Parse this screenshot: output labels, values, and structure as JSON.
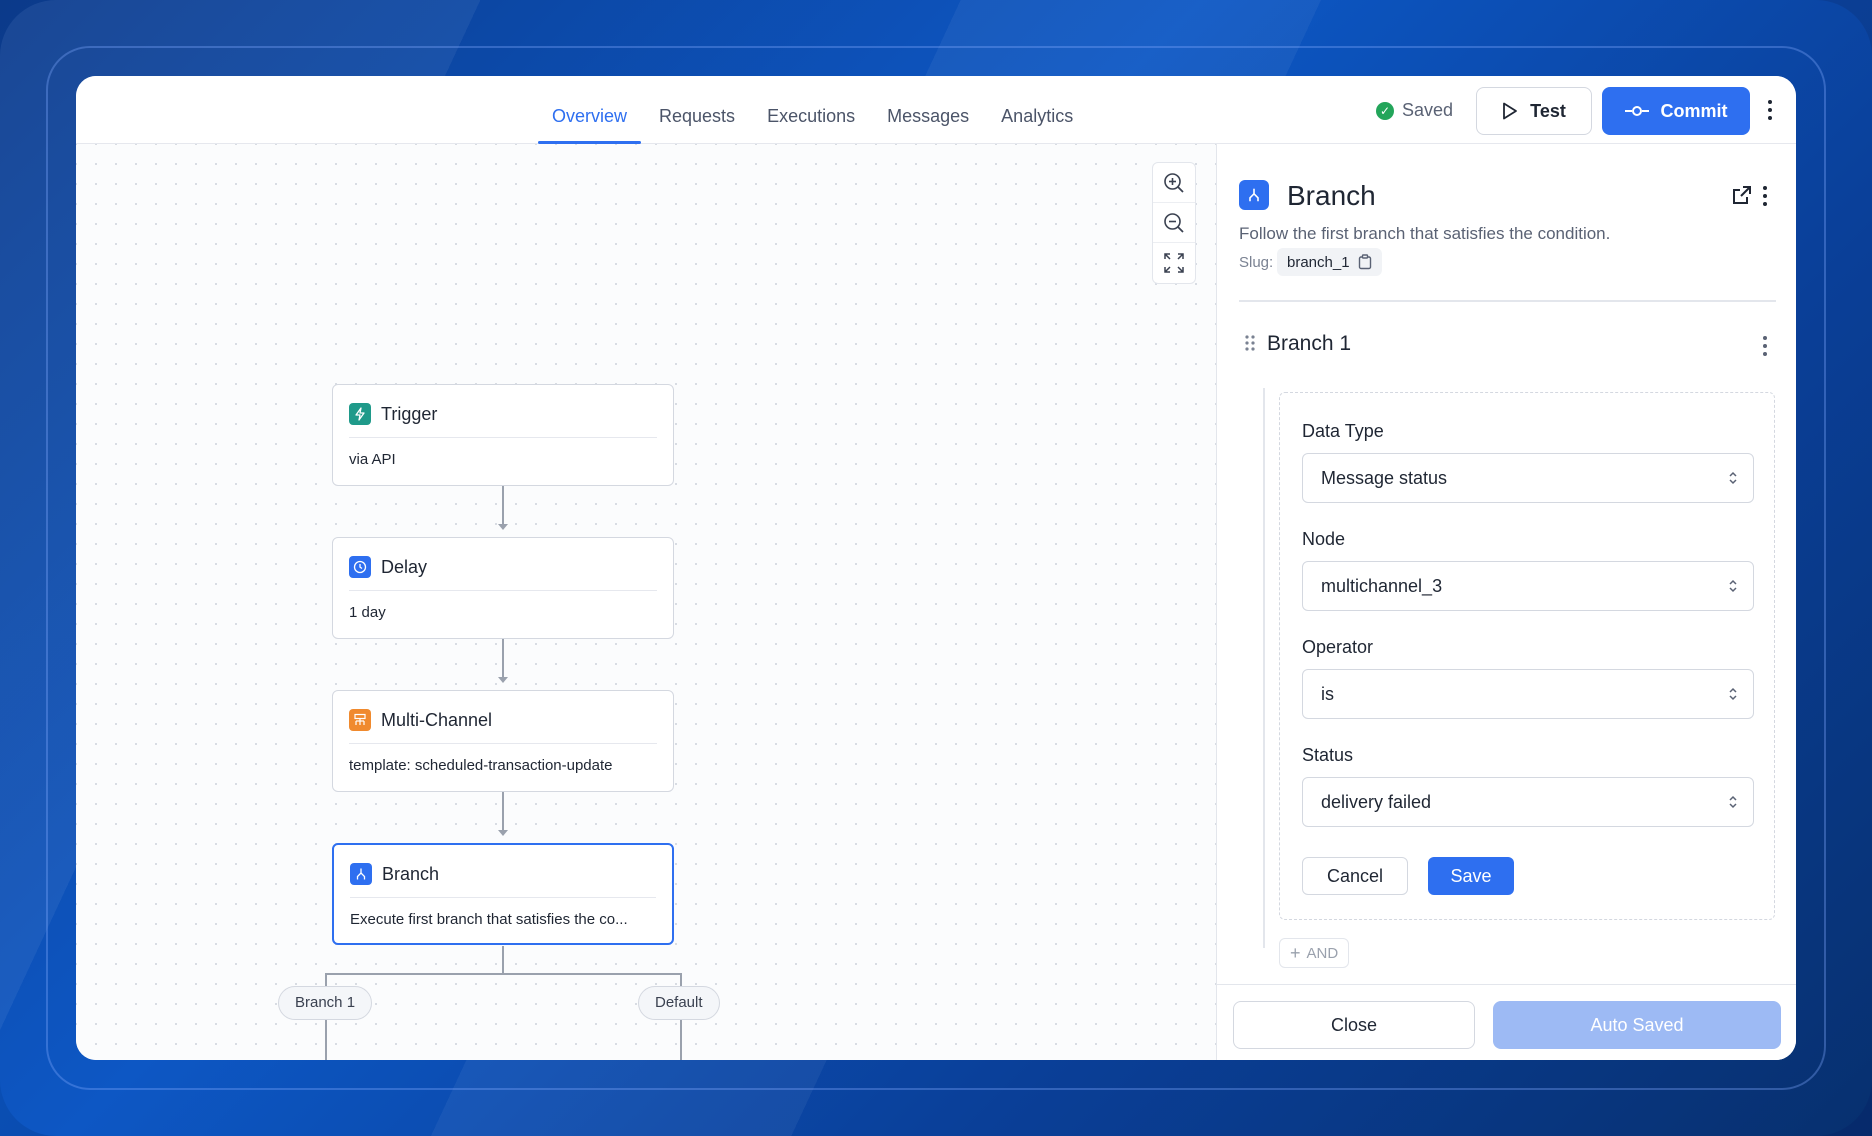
{
  "tabs": [
    {
      "label": "Overview",
      "active": true
    },
    {
      "label": "Requests",
      "active": false
    },
    {
      "label": "Executions",
      "active": false
    },
    {
      "label": "Messages",
      "active": false
    },
    {
      "label": "Analytics",
      "active": false
    }
  ],
  "header": {
    "saved_label": "Saved",
    "test_label": "Test",
    "commit_label": "Commit"
  },
  "nodes": [
    {
      "title": "Trigger",
      "body": "via API",
      "icon": "bolt-icon",
      "color": "#1f9a8a"
    },
    {
      "title": "Delay",
      "body": "1 day",
      "icon": "clock-icon",
      "color": "#2e6ff0"
    },
    {
      "title": "Multi-Channel",
      "body": "template: scheduled-transaction-update",
      "icon": "multichannel-icon",
      "color": "#f08a2e"
    },
    {
      "title": "Branch",
      "body": "Execute first branch that satisfies the co...",
      "icon": "branch-icon",
      "color": "#2e6ff0"
    }
  ],
  "branches": {
    "left": "Branch 1",
    "right": "Default"
  },
  "panel": {
    "title": "Branch",
    "description": "Follow the first branch that satisfies the condition.",
    "slug_label": "Slug:",
    "slug": "branch_1",
    "branch_title": "Branch 1",
    "fields": [
      {
        "label": "Data Type",
        "value": "Message status"
      },
      {
        "label": "Node",
        "value": "multichannel_3"
      },
      {
        "label": "Operator",
        "value": "is"
      },
      {
        "label": "Status",
        "value": "delivery failed"
      }
    ],
    "cancel_label": "Cancel",
    "save_label": "Save",
    "and_label": "AND",
    "close_label": "Close",
    "auto_saved_label": "Auto Saved"
  },
  "colors": {
    "accent": "#2e6ff0",
    "success": "#23a55a"
  }
}
